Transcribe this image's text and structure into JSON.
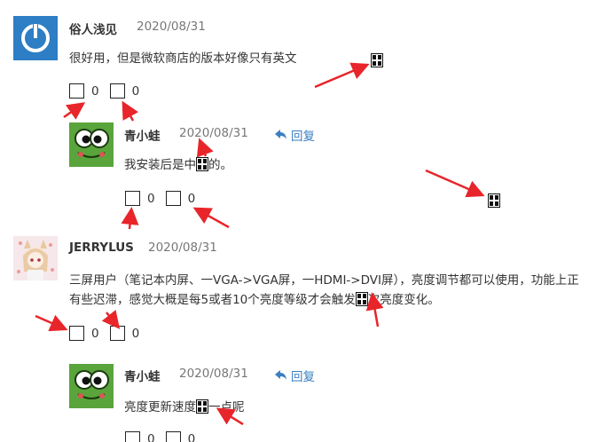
{
  "comments": [
    {
      "author": "俗人浅见",
      "date": "2020/08/31",
      "text": "很好用，但是微软商店的版本好像只有英文",
      "up": "0",
      "down": "0"
    },
    {
      "author": "青小蛙",
      "date": "2020/08/31",
      "reply_label": "回复",
      "text_a": "我安装后是中",
      "text_b": "的。",
      "up": "0",
      "down": "0"
    },
    {
      "author": "JERRYLUS",
      "date": "2020/08/31",
      "line1_a": "三屏用户（笔记本内屏、一VGA->VGA屏，一HDMI->DVI屏），亮度调节都可以使用，功能上",
      "line1_b": "正",
      "line2_a": "有些迟滞，感觉大概是每5或者10个亮度等级才会触发",
      "line2_b": "次亮度变化。",
      "up": "0",
      "down": "0"
    },
    {
      "author": "青小蛙",
      "date": "2020/08/31",
      "reply_label": "回复",
      "text_a": "亮度更新速度",
      "text_b": "一点呢",
      "up": "0",
      "down": "0"
    }
  ],
  "icons": {
    "reply": "reply-arrow-icon",
    "power_avatar": "power-icon",
    "frog_avatar": "frog-avatar",
    "anime_avatar": "anime-girl-avatar",
    "missing_glyph": "missing-glyph-icon"
  },
  "colors": {
    "link": "#3a7fc1",
    "annotation": "#e8252a",
    "power_avatar_bg": "#2d7ec4",
    "frog_bg": "#5aa43c"
  }
}
